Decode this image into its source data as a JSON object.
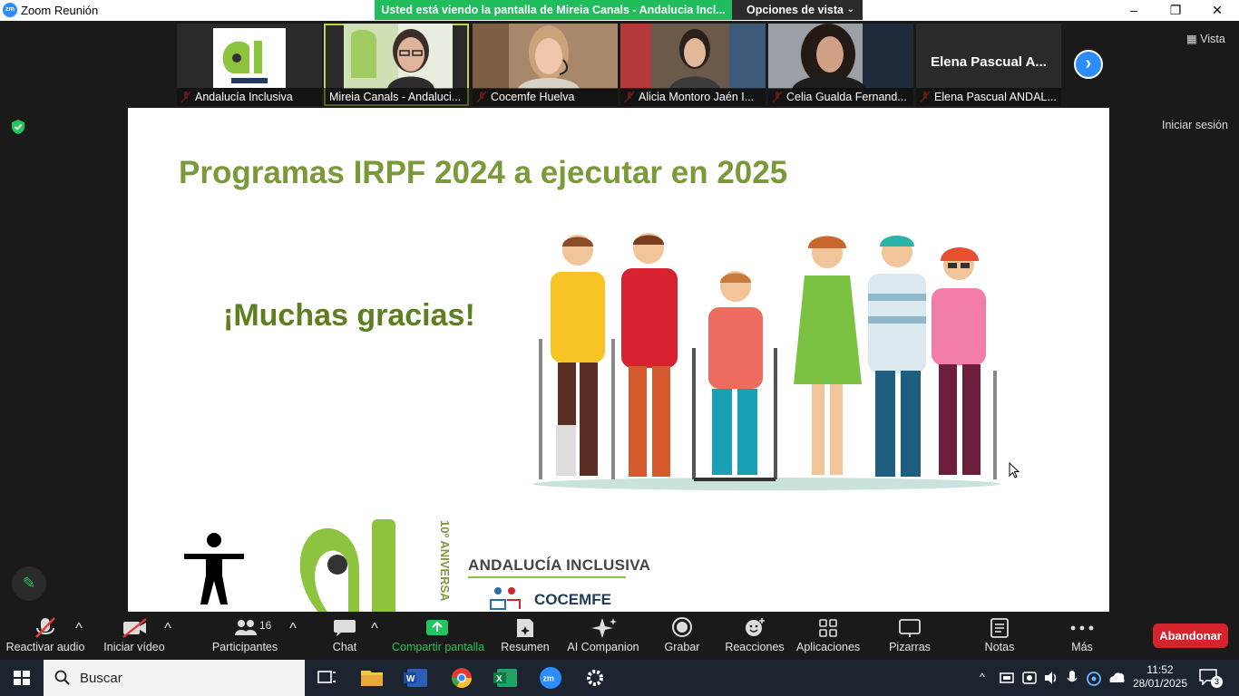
{
  "window": {
    "app_icon_text": "zm",
    "title": "Zoom Reunión",
    "minimize_label": "–",
    "restore_label": "❐",
    "close_label": "✕"
  },
  "share_banner": {
    "text": "Usted está viendo la pantalla de Mireia Canals - Andalucia Incl...",
    "view_options_label": "Opciones de vista"
  },
  "gallery": {
    "participants": [
      {
        "name": "Andalucía Inclusiva",
        "muted": true
      },
      {
        "name": "Mireia Canals - Andaluci...",
        "muted": false,
        "active_speaker": true
      },
      {
        "name": "Cocemfe Huelva",
        "muted": true
      },
      {
        "name": "Alicia Montoro Jaén I...",
        "muted": true
      },
      {
        "name": "Celia Gualda Fernand...",
        "muted": true
      },
      {
        "name": "Elena Pascual ANDAL...",
        "muted": true,
        "display_name": "Elena Pascual A..."
      }
    ],
    "view_label": "Vista",
    "sign_in_label": "Iniciar sesión"
  },
  "slide": {
    "title": "Programas IRPF 2024 a ejecutar en 2025",
    "thanks": "¡Muchas gracias!",
    "anniversary": "10º ANIVERSA",
    "brand_name": "ANDALUCÍA INCLUSIVA",
    "brand_sub": "COCEMFE"
  },
  "toolbar": {
    "audio": "Reactivar audio",
    "video": "Iniciar vídeo",
    "participants": "Participantes",
    "participants_count": "16",
    "chat": "Chat",
    "share": "Compartir pantalla",
    "summary": "Resumen",
    "companion": "AI Companion",
    "record": "Grabar",
    "reactions": "Reacciones",
    "apps": "Aplicaciones",
    "whiteboards": "Pizarras",
    "notes": "Notas",
    "more": "Más",
    "leave": "Abandonar"
  },
  "taskbar": {
    "search_placeholder": "Buscar",
    "time": "11:52",
    "date": "28/01/2025",
    "notification_count": "3"
  },
  "colors": {
    "zoom_blue": "#2d8cff",
    "share_green": "#20bd5c",
    "leave_red": "#d4232b",
    "slide_green": "#7a9a3a"
  }
}
